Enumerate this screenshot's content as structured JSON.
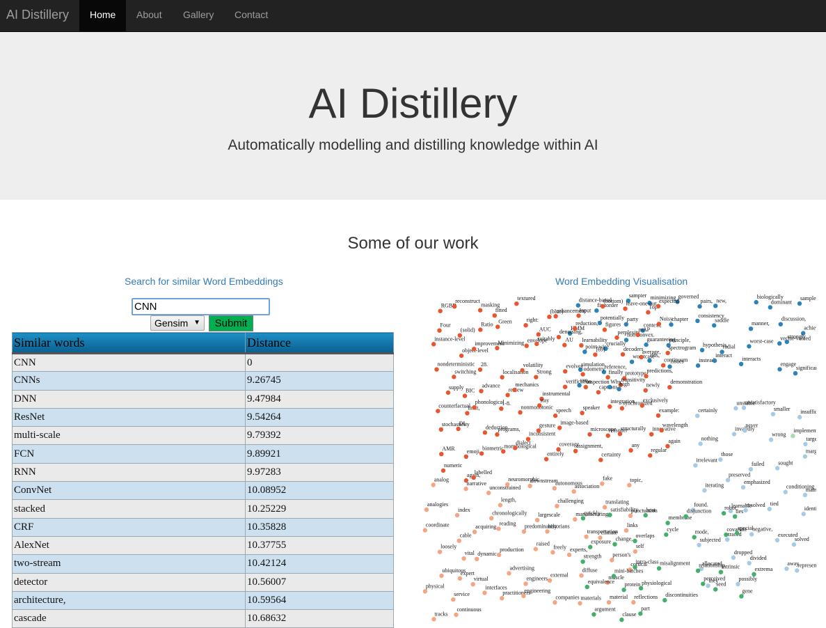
{
  "navbar": {
    "brand": "AI Distillery",
    "items": [
      {
        "label": "Home",
        "active": true
      },
      {
        "label": "About",
        "active": false
      },
      {
        "label": "Gallery",
        "active": false
      },
      {
        "label": "Contact",
        "active": false
      }
    ]
  },
  "jumbotron": {
    "title": "AI Distillery",
    "subtitle": "Automatically modelling and distilling knowledge within AI"
  },
  "section": {
    "title": "Some of our work"
  },
  "search_panel": {
    "title": "Search for similar Word Embeddings",
    "query_value": "CNN",
    "model_selected": "Gensim",
    "submit_label": "Submit",
    "table_headers": [
      "Similar words",
      "Distance"
    ],
    "rows": [
      {
        "word": "CNN",
        "distance": "0"
      },
      {
        "word": "CNNs",
        "distance": "9.26745"
      },
      {
        "word": "DNN",
        "distance": "9.47984"
      },
      {
        "word": "ResNet",
        "distance": "9.54264"
      },
      {
        "word": "multi-scale",
        "distance": "9.79392"
      },
      {
        "word": "FCN",
        "distance": "9.89921"
      },
      {
        "word": "RNN",
        "distance": "9.97283"
      },
      {
        "word": "ConvNet",
        "distance": "10.08952"
      },
      {
        "word": "stacked",
        "distance": "10.25229"
      },
      {
        "word": "CRF",
        "distance": "10.35828"
      },
      {
        "word": "AlexNet",
        "distance": "10.37755"
      },
      {
        "word": "two-stream",
        "distance": "10.42124"
      },
      {
        "word": "detector",
        "distance": "10.56007"
      },
      {
        "word": "architecture,",
        "distance": "10.59564"
      },
      {
        "word": "cascade",
        "distance": "10.68632"
      }
    ]
  },
  "visualisation": {
    "title": "Word Embedding Visualisation",
    "colors": {
      "red": "#e8552e",
      "orange": "#f5a582",
      "blue": "#2b83ba",
      "lightblue": "#a6cbe6",
      "green": "#41b06a",
      "lightgreen": "#a7dcb1"
    },
    "points": [
      {
        "w": "RGBD",
        "c": "red"
      },
      {
        "w": "reconstruct",
        "c": "red"
      },
      {
        "w": "masking",
        "c": "red"
      },
      {
        "w": "fitted",
        "c": "red"
      },
      {
        "w": "distance-based",
        "c": "blue"
      },
      {
        "w": "firstorder",
        "c": "blue"
      },
      {
        "w": "sampler",
        "c": "blue"
      },
      {
        "w": "minimizing",
        "c": "blue"
      },
      {
        "w": "governed",
        "c": "blue"
      },
      {
        "w": "pairs,",
        "c": "blue"
      },
      {
        "w": "textured",
        "c": "red"
      },
      {
        "w": "(blue)",
        "c": "red"
      },
      {
        "w": "new,",
        "c": "blue"
      },
      {
        "w": "biologically",
        "c": "blue"
      },
      {
        "w": "dominant",
        "c": "blue"
      },
      {
        "w": "samplers",
        "c": "blue"
      },
      {
        "w": "HMM",
        "c": "blue"
      },
      {
        "w": "potentially",
        "c": "blue"
      },
      {
        "w": "party",
        "c": "blue"
      },
      {
        "w": "context,",
        "c": "blue"
      },
      {
        "w": "chapter",
        "c": "blue"
      },
      {
        "w": "enhancement",
        "c": "red"
      },
      {
        "w": "Input",
        "c": "red"
      },
      {
        "w": "(bottom)",
        "c": "red"
      },
      {
        "w": "leave-one-out",
        "c": "red"
      },
      {
        "w": "Top",
        "c": "red"
      },
      {
        "w": "expected",
        "c": "red"
      },
      {
        "w": "consistency",
        "c": "blue"
      },
      {
        "w": "saddle",
        "c": "blue"
      },
      {
        "w": "manner,",
        "c": "blue"
      },
      {
        "w": "discussion,",
        "c": "blue"
      },
      {
        "w": "Four",
        "c": "red"
      },
      {
        "w": "(solid)",
        "c": "red"
      },
      {
        "w": "Ratio",
        "c": "red"
      },
      {
        "w": "Green",
        "c": "red"
      },
      {
        "w": "right:",
        "c": "red"
      },
      {
        "w": "AUC",
        "c": "red"
      },
      {
        "w": "achieved",
        "c": "blue"
      },
      {
        "w": "point-wise",
        "c": "blue"
      },
      {
        "w": "crucially",
        "c": "blue"
      },
      {
        "w": "non-convex.",
        "c": "blue"
      },
      {
        "w": "guaranteeing",
        "c": "blue"
      },
      {
        "w": "principle,",
        "c": "blue"
      },
      {
        "w": "hypothesis,",
        "c": "blue"
      },
      {
        "w": "denoising,",
        "c": "red"
      },
      {
        "w": "reduction,",
        "c": "red"
      },
      {
        "w": "figures",
        "c": "red"
      },
      {
        "w": "perplexity",
        "c": "red"
      },
      {
        "w": "radial",
        "c": "blue"
      },
      {
        "w": "worst-case",
        "c": "blue"
      },
      {
        "w": "mAP",
        "c": "red"
      },
      {
        "w": "vector-valued",
        "c": "blue"
      },
      {
        "w": "strongly",
        "c": "blue"
      },
      {
        "w": "simulation,",
        "c": "blue"
      },
      {
        "w": "reference,",
        "c": "blue"
      },
      {
        "w": "certainly",
        "c": "lightblue"
      },
      {
        "w": "Noisy",
        "c": "red"
      },
      {
        "w": "instance-level",
        "c": "red"
      },
      {
        "w": "object-level",
        "c": "red"
      },
      {
        "w": "worstcase",
        "c": "blue"
      },
      {
        "w": "this,",
        "c": "blue"
      },
      {
        "w": "issues",
        "c": "blue"
      },
      {
        "w": "improvement",
        "c": "red"
      },
      {
        "w": "Minimizing",
        "c": "red"
      },
      {
        "w": "envelope",
        "c": "red"
      },
      {
        "w": "suitably",
        "c": "red"
      },
      {
        "w": "AU",
        "c": "red"
      },
      {
        "w": "learnability",
        "c": "red"
      },
      {
        "w": "instead,",
        "c": "blue"
      },
      {
        "w": "[69]",
        "c": "red"
      },
      {
        "w": "decoders",
        "c": "red"
      },
      {
        "w": "average,",
        "c": "red"
      },
      {
        "w": "spectrogram",
        "c": "red"
      },
      {
        "w": "nondeterministic",
        "c": "red"
      },
      {
        "w": "switching",
        "c": "red"
      },
      {
        "w": "interact",
        "c": "blue"
      },
      {
        "w": "interacts",
        "c": "blue"
      },
      {
        "w": "quickly",
        "c": "green"
      },
      {
        "w": "28.",
        "c": "red"
      },
      {
        "w": "localisation",
        "c": "red"
      },
      {
        "w": "volatility",
        "c": "red"
      },
      {
        "w": "Strong",
        "c": "red"
      },
      {
        "w": "evolves",
        "c": "red"
      },
      {
        "w": "engage",
        "c": "blue"
      },
      {
        "w": "significantly",
        "c": "blue"
      },
      {
        "w": "unstable",
        "c": "lightblue"
      },
      {
        "w": "odometry",
        "c": "red"
      },
      {
        "w": "finally",
        "c": "red"
      },
      {
        "w": "prototype",
        "c": "red"
      },
      {
        "w": "predictions,",
        "c": "red"
      },
      {
        "w": "continuum",
        "c": "red"
      },
      {
        "w": "supply",
        "c": "red"
      },
      {
        "w": "use,",
        "c": "blue"
      },
      {
        "w": "BIC",
        "c": "red"
      },
      {
        "w": "advance",
        "c": "red"
      },
      {
        "w": "review",
        "c": "red"
      },
      {
        "w": "mechanics",
        "c": "red"
      },
      {
        "w": "instrumental",
        "c": "red"
      },
      {
        "w": "verification",
        "c": "red"
      },
      {
        "w": "inspection",
        "c": "red"
      },
      {
        "w": "captions,",
        "c": "red"
      },
      {
        "w": "transitivity",
        "c": "red"
      },
      {
        "w": "Why",
        "c": "blue"
      },
      {
        "w": "unsatisfactory",
        "c": "lightblue"
      },
      {
        "w": "high",
        "c": "blue"
      },
      {
        "w": "smaller",
        "c": "lightblue"
      },
      {
        "w": "insufficient",
        "c": "lightblue"
      },
      {
        "w": "newly",
        "c": "red"
      },
      {
        "w": "demonstration",
        "c": "red"
      },
      {
        "w": "counterfactual",
        "c": "red"
      },
      {
        "w": "limit,",
        "c": "red"
      },
      {
        "w": "phonological",
        "c": "red"
      },
      {
        "w": "1-8.",
        "c": "red"
      },
      {
        "w": "nonmonotonic",
        "c": "red"
      },
      {
        "w": "stay",
        "c": "red"
      },
      {
        "w": "speech",
        "c": "red"
      },
      {
        "w": "speaker",
        "c": "red"
      },
      {
        "w": "integration,",
        "c": "red"
      },
      {
        "w": "synchronized",
        "c": "red"
      },
      {
        "w": "exclusively",
        "c": "red"
      },
      {
        "w": "example:",
        "c": "red"
      },
      {
        "w": "implementable",
        "c": "lightgreen"
      },
      {
        "w": "stochasticity",
        "c": "red"
      },
      {
        "w": "DL",
        "c": "red"
      },
      {
        "w": "deduction",
        "c": "red"
      },
      {
        "w": "programs,",
        "c": "red"
      },
      {
        "w": "inconsistent",
        "c": "red"
      },
      {
        "w": "nothing",
        "c": "lightblue"
      },
      {
        "w": "invalidly",
        "c": "lightblue"
      },
      {
        "w": "never",
        "c": "lightblue"
      },
      {
        "w": "wrong",
        "c": "lightblue"
      },
      {
        "w": "target",
        "c": "lightblue"
      },
      {
        "w": "gesture",
        "c": "red"
      },
      {
        "w": "image-based",
        "c": "red"
      },
      {
        "w": "microscope",
        "c": "red"
      },
      {
        "w": "reasoner",
        "c": "red"
      },
      {
        "w": "structurally",
        "c": "red"
      },
      {
        "w": "irrelevant",
        "c": "lightblue"
      },
      {
        "w": "innovative",
        "c": "red"
      },
      {
        "w": "wavelength",
        "c": "red"
      },
      {
        "w": "AMR",
        "c": "red"
      },
      {
        "w": "those",
        "c": "lightblue"
      },
      {
        "w": "emoji",
        "c": "red"
      },
      {
        "w": "biometric",
        "c": "red"
      },
      {
        "w": "morphological",
        "c": "red"
      },
      {
        "w": "dialect",
        "c": "red"
      },
      {
        "w": "failed",
        "c": "lightblue"
      },
      {
        "w": "entirely",
        "c": "red"
      },
      {
        "w": "sought",
        "c": "lightblue"
      },
      {
        "w": "analog",
        "c": "orange"
      },
      {
        "w": "narrative",
        "c": "orange"
      },
      {
        "w": "coverage",
        "c": "red"
      },
      {
        "w": "assignment,",
        "c": "red"
      },
      {
        "w": "certainty",
        "c": "red"
      },
      {
        "w": "unconstrained",
        "c": "orange"
      },
      {
        "w": "neuromorphic",
        "c": "orange"
      },
      {
        "w": "downstream",
        "c": "orange"
      },
      {
        "w": "autonomous",
        "c": "orange"
      },
      {
        "w": "association",
        "c": "orange"
      },
      {
        "w": "marginalization",
        "c": "lightblue"
      },
      {
        "w": "iterating",
        "c": "lightblue"
      },
      {
        "w": "preserved",
        "c": "lightblue"
      },
      {
        "w": "emphasized",
        "c": "lightblue"
      },
      {
        "w": "fake",
        "c": "orange"
      },
      {
        "w": "topic,",
        "c": "orange"
      },
      {
        "w": "analogies",
        "c": "orange"
      },
      {
        "w": "index",
        "c": "orange"
      },
      {
        "w": "chronologically",
        "c": "orange"
      },
      {
        "w": "length,",
        "c": "orange"
      },
      {
        "w": "largescale",
        "c": "orange"
      },
      {
        "w": "conditioning",
        "c": "lightblue"
      },
      {
        "w": "maintained",
        "c": "lightblue"
      },
      {
        "w": "found.",
        "c": "lightblue"
      },
      {
        "w": "challenging",
        "c": "orange"
      },
      {
        "w": "learnable",
        "c": "lightblue"
      },
      {
        "w": "manufacturing",
        "c": "orange"
      },
      {
        "w": "translating",
        "c": "orange"
      },
      {
        "w": "punctuation",
        "c": "orange"
      },
      {
        "w": "coordinate",
        "c": "orange"
      },
      {
        "w": "resolved",
        "c": "lightblue"
      },
      {
        "w": "tied",
        "c": "lightblue"
      },
      {
        "w": "identical",
        "c": "lightblue"
      },
      {
        "w": "cable",
        "c": "orange"
      },
      {
        "w": "acquiring",
        "c": "orange"
      },
      {
        "w": "reading",
        "c": "orange"
      },
      {
        "w": "predominantly",
        "c": "orange"
      },
      {
        "w": "historians",
        "c": "orange"
      },
      {
        "w": "satisfiability",
        "c": "green"
      },
      {
        "w": "subjected",
        "c": "lightblue"
      },
      {
        "w": "traced",
        "c": "lightblue"
      },
      {
        "w": "transportation",
        "c": "orange"
      },
      {
        "w": "climate",
        "c": "orange"
      },
      {
        "w": "links",
        "c": "orange"
      },
      {
        "w": "loosely",
        "c": "orange"
      },
      {
        "w": "host",
        "c": "green"
      },
      {
        "w": "membrane",
        "c": "green"
      },
      {
        "w": "disjunction",
        "c": "green"
      },
      {
        "w": "negative,",
        "c": "lightblue"
      },
      {
        "w": "vital",
        "c": "orange"
      },
      {
        "w": "dynamic",
        "c": "orange"
      },
      {
        "w": "production",
        "c": "orange"
      },
      {
        "w": "raised",
        "c": "orange"
      },
      {
        "w": "freely",
        "c": "orange"
      },
      {
        "w": "experts,",
        "c": "orange"
      },
      {
        "w": "robot,",
        "c": "green"
      },
      {
        "w": "ties",
        "c": "green"
      },
      {
        "w": "executed",
        "c": "lightblue"
      },
      {
        "w": "solved",
        "c": "lightblue"
      },
      {
        "w": "allocated",
        "c": "lightblue"
      },
      {
        "w": "dropped",
        "c": "lightblue"
      },
      {
        "w": "person's",
        "c": "orange"
      },
      {
        "w": "self",
        "c": "orange"
      },
      {
        "w": "divided",
        "c": "lightblue"
      },
      {
        "w": "away",
        "c": "lightblue"
      },
      {
        "w": "ubiquitous",
        "c": "orange"
      },
      {
        "w": "exposure",
        "c": "green"
      },
      {
        "w": "representative",
        "c": "lightblue"
      },
      {
        "w": "expert",
        "c": "orange"
      },
      {
        "w": "change,",
        "c": "green"
      },
      {
        "w": "overlaps",
        "c": "green"
      },
      {
        "w": "cycle",
        "c": "green"
      },
      {
        "w": "mode,",
        "c": "green"
      },
      {
        "w": "virtual",
        "c": "orange"
      },
      {
        "w": "advertising",
        "c": "orange"
      },
      {
        "w": "engineers",
        "c": "orange"
      },
      {
        "w": "external",
        "c": "orange"
      },
      {
        "w": "diffuse",
        "c": "orange"
      },
      {
        "w": "covariate",
        "c": "green"
      },
      {
        "w": "special",
        "c": "green"
      },
      {
        "w": "muscle",
        "c": "orange"
      },
      {
        "w": "cortical",
        "c": "orange"
      },
      {
        "w": "strength",
        "c": "green"
      },
      {
        "w": "mini-batches",
        "c": "green"
      },
      {
        "w": "physical",
        "c": "orange"
      },
      {
        "w": "service",
        "c": "orange"
      },
      {
        "w": "interfaces",
        "c": "orange"
      },
      {
        "w": "practitioners",
        "c": "orange"
      },
      {
        "w": "intra-class",
        "c": "green"
      },
      {
        "w": "misalignment",
        "c": "green"
      },
      {
        "w": "relationship",
        "c": "green"
      },
      {
        "w": "any",
        "c": "red"
      },
      {
        "w": "regular",
        "c": "red"
      },
      {
        "w": "again",
        "c": "red"
      },
      {
        "w": "engineering",
        "c": "orange"
      },
      {
        "w": "companies",
        "c": "orange"
      },
      {
        "w": "intrinsic",
        "c": "green"
      },
      {
        "w": "extrema",
        "c": "green"
      },
      {
        "w": "equivalence",
        "c": "green"
      },
      {
        "w": "numeric",
        "c": "red"
      },
      {
        "w": "protein",
        "c": "green"
      },
      {
        "w": "physiological",
        "c": "green"
      },
      {
        "w": "discontinuities",
        "c": "green"
      },
      {
        "w": "perceived",
        "c": "green"
      },
      {
        "w": "seed",
        "c": "green"
      },
      {
        "w": "again,",
        "c": "red"
      },
      {
        "w": "they",
        "c": "lightblue"
      },
      {
        "w": "gene",
        "c": "green"
      },
      {
        "w": "materials",
        "c": "orange"
      },
      {
        "w": "argument",
        "c": "green"
      },
      {
        "w": "material",
        "c": "orange"
      },
      {
        "w": "reflections",
        "c": "orange"
      },
      {
        "w": "clause",
        "c": "green"
      },
      {
        "w": "labelled",
        "c": "red"
      },
      {
        "w": "possibly",
        "c": "lightblue"
      },
      {
        "w": "tracks",
        "c": "orange"
      },
      {
        "w": "continuous",
        "c": "orange"
      },
      {
        "w": "part",
        "c": "green"
      }
    ]
  }
}
